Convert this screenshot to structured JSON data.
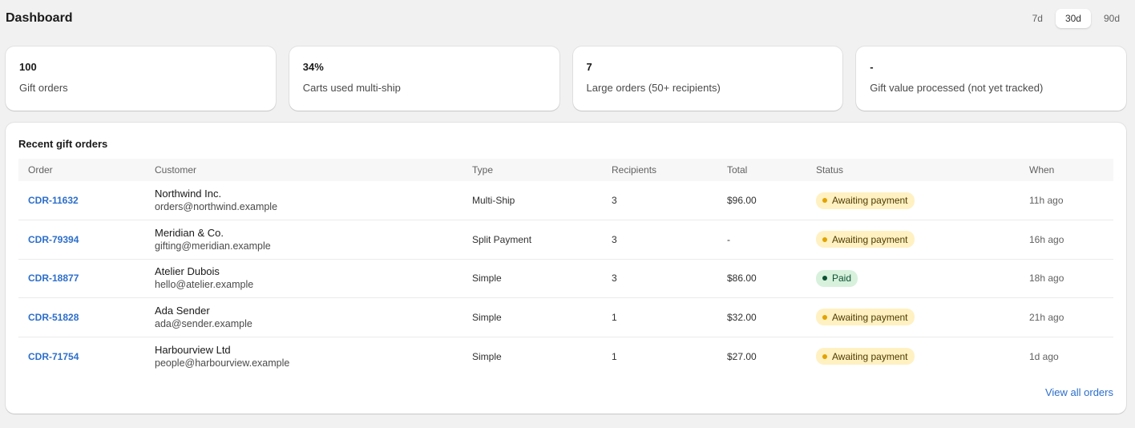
{
  "header": {
    "title": "Dashboard",
    "ranges": [
      {
        "label": "7d",
        "active": false
      },
      {
        "label": "30d",
        "active": true
      },
      {
        "label": "90d",
        "active": false
      }
    ]
  },
  "stats": [
    {
      "value": "100",
      "label": "Gift orders"
    },
    {
      "value": "34%",
      "label": "Carts used multi-ship"
    },
    {
      "value": "7",
      "label": "Large orders (50+ recipients)"
    },
    {
      "value": "-",
      "label": "Gift value processed (not yet tracked)"
    }
  ],
  "orders": {
    "title": "Recent gift orders",
    "columns": [
      "Order",
      "Customer",
      "Type",
      "Recipients",
      "Total",
      "Status",
      "When"
    ],
    "rows": [
      {
        "order": "CDR-11632",
        "name": "Northwind Inc.",
        "email": "orders@northwind.example",
        "type": "Multi-Ship",
        "recipients": "3",
        "total": "$96.00",
        "status": "Awaiting payment",
        "when": "11h ago"
      },
      {
        "order": "CDR-79394",
        "name": "Meridian & Co.",
        "email": "gifting@meridian.example",
        "type": "Split Payment",
        "recipients": "3",
        "total": "-",
        "status": "Awaiting payment",
        "when": "16h ago"
      },
      {
        "order": "CDR-18877",
        "name": "Atelier Dubois",
        "email": "hello@atelier.example",
        "type": "Simple",
        "recipients": "3",
        "total": "$86.00",
        "status": "Paid",
        "when": "18h ago"
      },
      {
        "order": "CDR-51828",
        "name": "Ada Sender",
        "email": "ada@sender.example",
        "type": "Simple",
        "recipients": "1",
        "total": "$32.00",
        "status": "Awaiting payment",
        "when": "21h ago"
      },
      {
        "order": "CDR-71754",
        "name": "Harbourview Ltd",
        "email": "people@harbourview.example",
        "type": "Simple",
        "recipients": "1",
        "total": "$27.00",
        "status": "Awaiting payment",
        "when": "1d ago"
      }
    ],
    "view_all": "View all orders"
  },
  "colors": {
    "link": "#2c6ecb",
    "awaiting_bg": "#fff1c2",
    "awaiting_dot": "#e2a300",
    "paid_bg": "#d7f1dd",
    "paid_dot": "#0c5132"
  }
}
